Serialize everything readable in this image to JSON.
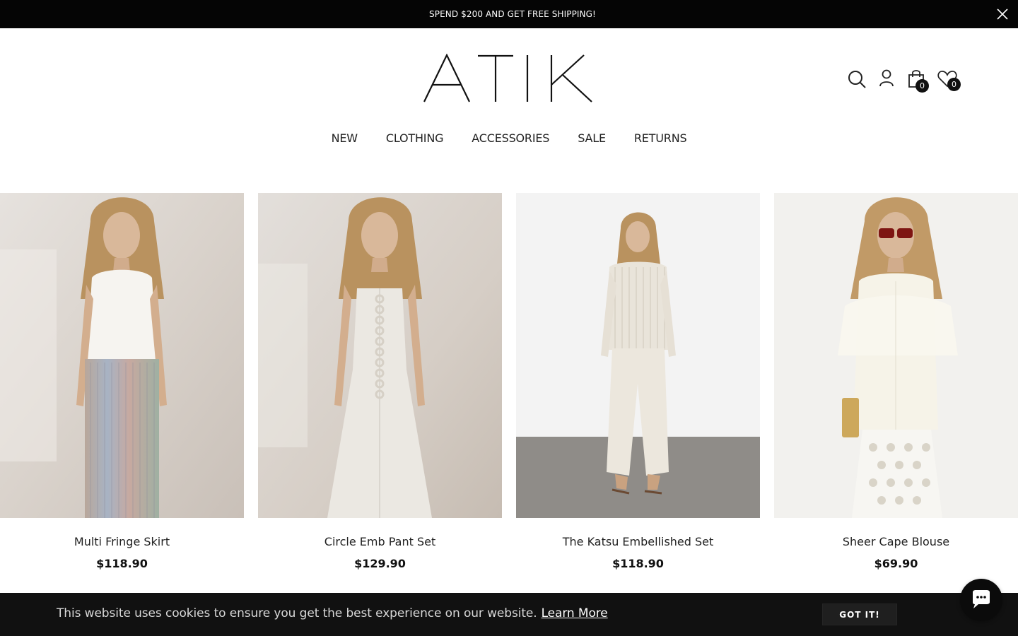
{
  "announcement": {
    "text": "SPEND $200 AND GET FREE SHIPPING!",
    "close_icon": "close-icon"
  },
  "brand": {
    "logo_text": "ATIK"
  },
  "header_icons": {
    "search": "search-icon",
    "account": "user-icon",
    "cart": {
      "icon": "shopping-bag-icon",
      "count": "0"
    },
    "wishlist": {
      "icon": "heart-icon",
      "count": "0"
    }
  },
  "nav": {
    "items": [
      "NEW",
      "CLOTHING",
      "ACCESSORIES",
      "SALE",
      "RETURNS"
    ]
  },
  "products": [
    {
      "title": "Multi Fringe Skirt",
      "price": "$118.90"
    },
    {
      "title": "Circle Emb Pant Set",
      "price": "$129.90"
    },
    {
      "title": "The Katsu Embellished Set",
      "price": "$118.90"
    },
    {
      "title": "Sheer Cape Blouse",
      "price": "$69.90"
    }
  ],
  "cookie_banner": {
    "text": "This website uses cookies to ensure you get the best experience on our website.",
    "link": "Learn More",
    "button": "GOT IT!"
  },
  "chat": {
    "icon": "chat-icon"
  },
  "colors": {
    "announcement_bg": "#050505",
    "cookie_bg": "#111111",
    "accent": "#000000"
  }
}
